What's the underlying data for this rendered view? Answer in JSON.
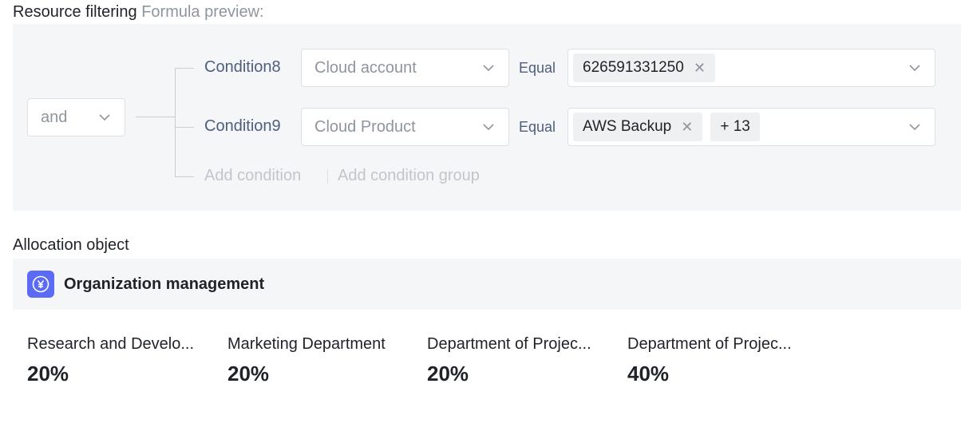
{
  "resource_filtering": {
    "title": "Resource filtering",
    "formula_label": "Formula preview:",
    "logic_operator": "and",
    "conditions": [
      {
        "label": "Condition8",
        "field": "Cloud account",
        "operator": "Equal",
        "tags": [
          "626591331250"
        ],
        "more": ""
      },
      {
        "label": "Condition9",
        "field": "Cloud Product",
        "operator": "Equal",
        "tags": [
          "AWS Backup"
        ],
        "more": "+ 13"
      }
    ],
    "add_condition": "Add condition",
    "add_condition_group": "Add condition group"
  },
  "allocation": {
    "title": "Allocation object",
    "org_title": "Organization management",
    "icon": "yuan-circle-icon",
    "accent_color": "#5b6bf5",
    "items": [
      {
        "name": "Research and Develo...",
        "percent": "20%"
      },
      {
        "name": "Marketing Department",
        "percent": "20%"
      },
      {
        "name": "Department of Projec...",
        "percent": "20%"
      },
      {
        "name": "Department of Projec...",
        "percent": "40%"
      }
    ]
  }
}
